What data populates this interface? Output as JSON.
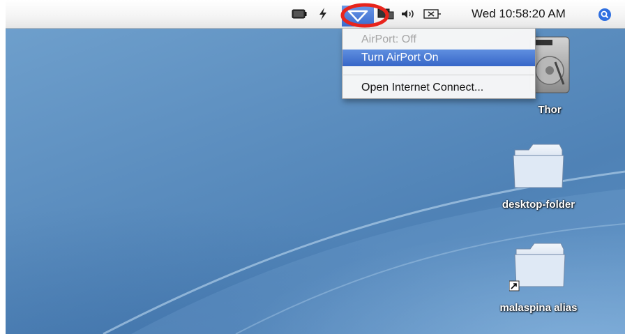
{
  "menubar": {
    "clock": "Wed 10:58:20 AM",
    "icons": [
      "battery-icon",
      "power-bolt-icon",
      "airport-icon",
      "display-icon",
      "volume-icon",
      "eject-icon",
      "spotlight-icon"
    ]
  },
  "airport_menu": {
    "status": "AirPort: Off",
    "items": [
      {
        "label": "Turn AirPort On",
        "highlighted": true
      },
      {
        "label": "Open Internet Connect..."
      }
    ],
    "highlight_color": "#3a6bd0"
  },
  "desktop": {
    "icons": [
      {
        "label": "Thor",
        "icon": "hard-drive-icon"
      },
      {
        "label": "desktop-folder",
        "icon": "folder-icon"
      },
      {
        "label": "malaspina alias",
        "icon": "folder-alias-icon"
      }
    ],
    "background_color": "#5d8fc0"
  },
  "annotation": {
    "color": "#e8241c",
    "shape": "circle around airport-icon"
  }
}
